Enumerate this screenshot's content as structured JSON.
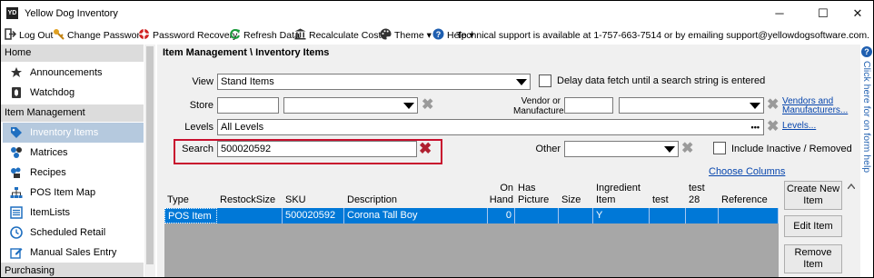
{
  "window": {
    "icon_text": "YD",
    "title": "Yellow Dog Inventory",
    "minimize": "─",
    "maximize": "☐",
    "close": "✕"
  },
  "menubar": {
    "items": [
      {
        "label": "Log Out",
        "icon": "logout-icon"
      },
      {
        "label": "Change Password",
        "icon": "key-icon"
      },
      {
        "label": "Password Recovery",
        "icon": "lifebuoy-icon"
      },
      {
        "label": "Refresh Data",
        "icon": "refresh-icon"
      },
      {
        "label": "Recalculate Costs",
        "icon": "bank-icon"
      },
      {
        "label": "Theme ▾",
        "icon": "palette-icon"
      },
      {
        "label": "Help ▾",
        "icon": "help-icon"
      }
    ],
    "support_text": "Technical support is available at 1-757-663-7514 or by emailing support@yellowdogsoftware.com."
  },
  "sidebar": {
    "sections": [
      {
        "title": "Home"
      },
      {
        "title": "Item Management"
      },
      {
        "title": "Purchasing"
      }
    ],
    "items": [
      {
        "label": "Announcements",
        "icon": "megaphone-icon"
      },
      {
        "label": "Watchdog",
        "icon": "watchdog-icon"
      },
      {
        "label": "Inventory Items",
        "icon": "tag-icon"
      },
      {
        "label": "Matrices",
        "icon": "matrix-icon"
      },
      {
        "label": "Recipes",
        "icon": "recipe-icon"
      },
      {
        "label": "POS Item Map",
        "icon": "sitemap-icon"
      },
      {
        "label": "ItemLists",
        "icon": "list-icon"
      },
      {
        "label": "Scheduled Retail",
        "icon": "clock-icon"
      },
      {
        "label": "Manual Sales Entry",
        "icon": "edit-icon"
      }
    ],
    "colors": {
      "active_bg": "#b5c9de",
      "header_bg": "#dcdcdc"
    }
  },
  "main": {
    "title": "Item Management \\ Inventory Items",
    "view_label": "View",
    "view_value": "Stand Items",
    "delay_label": "Delay data fetch until a search string is entered",
    "store_label": "Store",
    "store_value": "",
    "vendor_label_1": "Vendor or",
    "vendor_label_2": "Manufacturer",
    "vendors_link_1": "Vendors and",
    "vendors_link_2": "Manufacturers...",
    "levels_label": "Levels",
    "levels_value": "All Levels",
    "levels_ellipsis": "•••",
    "levels_link": "Levels...",
    "search_label": "Search",
    "search_value": "500020592",
    "other_label": "Other",
    "include_inactive_label": "Include Inactive / Removed",
    "choose_columns": "Choose Columns",
    "clear_symbol": "✖",
    "colors": {
      "highlight_border": "#c8102e",
      "selection": "#0078d7",
      "link": "#0645ad"
    }
  },
  "grid": {
    "columns": [
      {
        "label": "Type"
      },
      {
        "label": "RestockSize"
      },
      {
        "label": "SKU"
      },
      {
        "label": "Description"
      },
      {
        "label": "On Hand"
      },
      {
        "label": "Has Picture"
      },
      {
        "label": "Size"
      },
      {
        "label": "Ingredient Item"
      },
      {
        "label": "test"
      },
      {
        "label": "test 28"
      },
      {
        "label": "Reference"
      }
    ],
    "rows": [
      {
        "type": "POS Item",
        "restock_size": "",
        "sku": "500020592",
        "description": "Corona Tall Boy",
        "on_hand": "0",
        "has_picture": "",
        "size": "",
        "ingredient_item": "Y",
        "test": "",
        "test28": "",
        "reference": ""
      }
    ]
  },
  "buttons": {
    "create": "Create New Item",
    "edit": "Edit Item",
    "remove": "Remove Item"
  },
  "helpstrip": {
    "icon": "?",
    "text": "Click here for on form help"
  }
}
